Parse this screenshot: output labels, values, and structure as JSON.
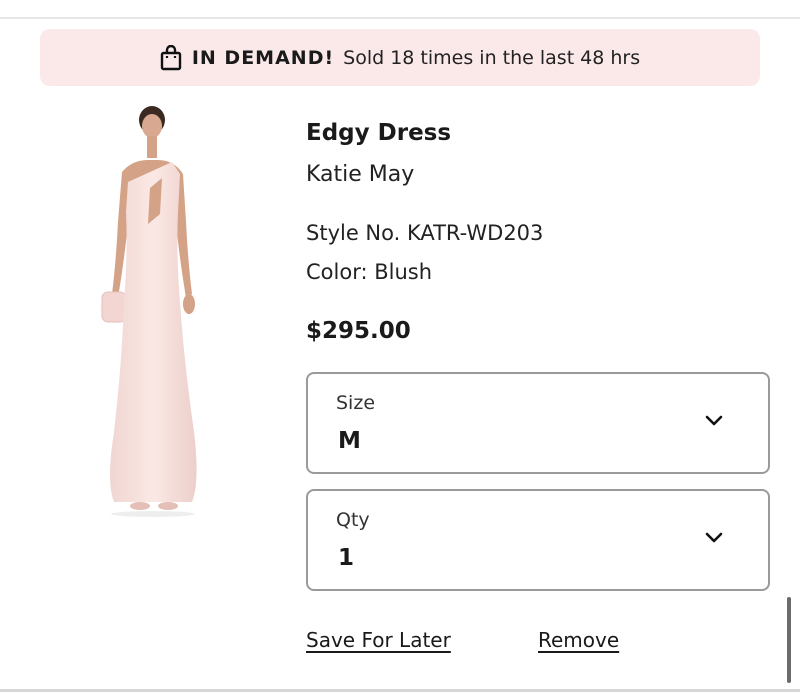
{
  "banner": {
    "strong": "IN DEMAND!",
    "text": "Sold 18 times in the last 48 hrs",
    "icon": "shopping-bag-icon",
    "background": "#fbe9ea"
  },
  "product": {
    "name": "Edgy Dress",
    "brand": "Katie May",
    "style_no": "Style No. KATR-WD203",
    "color": "Color: Blush",
    "price": "$295.00",
    "image": "blush-one-shoulder-gown-photo"
  },
  "size_select": {
    "label": "Size",
    "value": "M",
    "icon": "chevron-down-icon"
  },
  "qty_select": {
    "label": "Qty",
    "value": "1",
    "icon": "chevron-down-icon"
  },
  "actions": {
    "save_for_later": "Save For Later",
    "remove": "Remove"
  }
}
